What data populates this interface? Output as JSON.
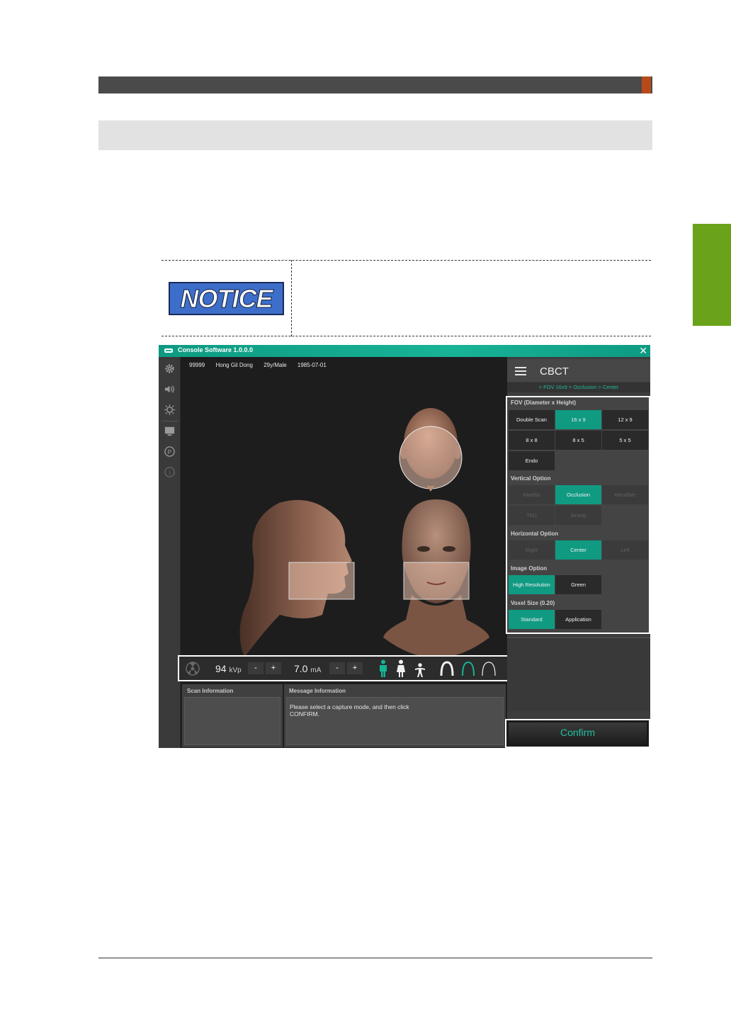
{
  "notice": {
    "badge": "NOTICE"
  },
  "console": {
    "title": "Console Software  1.0.0.0",
    "patient": {
      "id": "99999",
      "name": "Hong Gil Dong",
      "age_sex": "29y/Male",
      "dob": "1985-07-01"
    },
    "params": {
      "kvp": "94",
      "kvp_unit": "kVp",
      "ma": "7.0",
      "ma_unit": "mA",
      "minus": "-",
      "plus": "+"
    },
    "scan_info": {
      "title": "Scan Information"
    },
    "message": {
      "title": "Message Information",
      "text": "Please select a capture mode, and then click CONFIRM."
    },
    "panel": {
      "title": "CBCT",
      "breadcrumb": "> FOV 16x9 > Occlusion > Center",
      "fov": {
        "label": "FOV (Diameter x Height)",
        "options": [
          "Double Scan",
          "16 x 9",
          "12 x 9",
          "8 x 8",
          "8 x 5",
          "5 x 5",
          "Endo"
        ]
      },
      "vertical": {
        "label": "Vertical Option",
        "options": [
          "Maxilla",
          "Occlusion",
          "Mandible",
          "TMJ",
          "Airway"
        ]
      },
      "horizontal": {
        "label": "Horizontal Option",
        "options": [
          "Right",
          "Center",
          "Left"
        ]
      },
      "image": {
        "label": "Image Option",
        "options": [
          "High Resolution",
          "Green"
        ]
      },
      "voxel": {
        "label": "Voxel Size (0.20)",
        "options": [
          "Standard",
          "Application"
        ]
      },
      "confirm": "Confirm"
    },
    "colors": {
      "accent": "#109a82",
      "title_bar": "#18b397",
      "notice_blue": "#3d6ec9",
      "tab_green": "#6aa219",
      "header_accent": "#b84a1a"
    }
  }
}
